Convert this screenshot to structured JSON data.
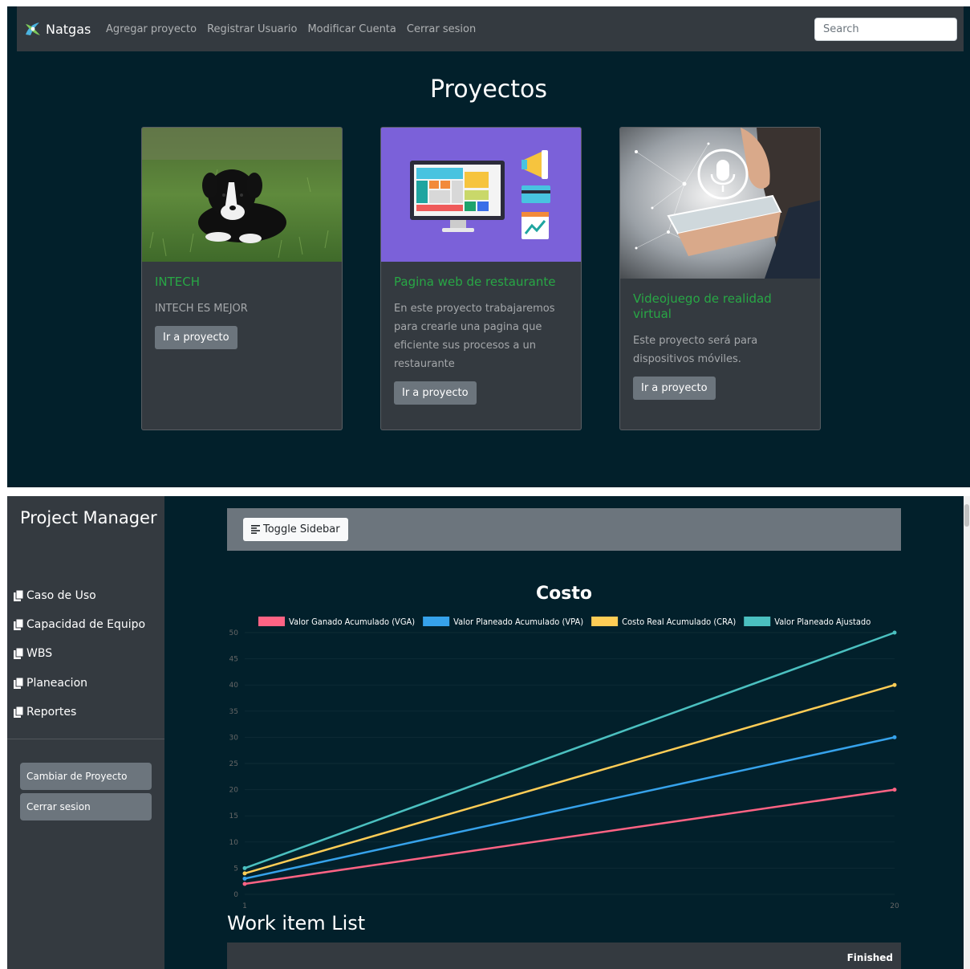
{
  "top": {
    "brand": "Natgas",
    "nav_links": [
      "Agregar proyecto",
      "Registrar Usuario",
      "Modificar Cuenta",
      "Cerrar sesion"
    ],
    "search_placeholder": "Search",
    "heading": "Proyectos",
    "cards": [
      {
        "title": "INTECH",
        "text": "INTECH ES MEJOR",
        "button": "Ir a proyecto",
        "image": "puppy-photo"
      },
      {
        "title": "Pagina web de restaurante",
        "text": "En este proyecto trabajaremos para crearle una pagina que eficiente sus procesos a un restaurante",
        "button": "Ir a proyecto",
        "image": "web-dashboard-illustration"
      },
      {
        "title": "Videojuego de realidad virtual",
        "text": "Este proyecto será para dispositivos móviles.",
        "button": "Ir a proyecto",
        "image": "voice-assistant-photo"
      }
    ]
  },
  "bottom": {
    "sidebar": {
      "title": "Project Manager",
      "items": [
        "Caso de Uso",
        "Capacidad de Equipo",
        "WBS",
        "Planeacion",
        "Reportes"
      ],
      "buttons": [
        "Cambiar de Proyecto",
        "Cerrar sesion"
      ]
    },
    "toggle_label": "Toggle Sidebar",
    "work_item_title": "Work item List",
    "table_header": "Finished"
  },
  "colors": {
    "vga": "#ff6384",
    "vpa": "#36a2eb",
    "cra": "#ffcd56",
    "ajustado": "#4bc0c0"
  },
  "chart_data": {
    "type": "line",
    "title": "Costo",
    "x": [
      1,
      20
    ],
    "ylim": [
      0,
      50
    ],
    "yticks": [
      0,
      5,
      10,
      15,
      20,
      25,
      30,
      35,
      40,
      45,
      50
    ],
    "legend_position": "top",
    "series": [
      {
        "name": "Valor Ganado Acumulado (VGA)",
        "color": "#ff6384",
        "values": [
          2,
          20
        ]
      },
      {
        "name": "Valor Planeado Acumulado (VPA)",
        "color": "#36a2eb",
        "values": [
          3,
          30
        ]
      },
      {
        "name": "Costo Real Acumulado (CRA)",
        "color": "#ffcd56",
        "values": [
          4,
          40
        ]
      },
      {
        "name": "Valor Planeado Ajustado",
        "color": "#4bc0c0",
        "values": [
          5,
          50
        ]
      }
    ]
  }
}
